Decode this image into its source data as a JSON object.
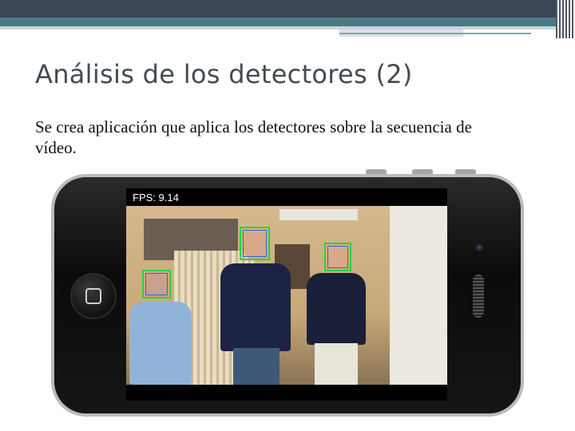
{
  "slide": {
    "title": "Análisis de los detectores (2)",
    "body": "Se crea aplicación que aplica los detectores sobre la secuencia de vídeo."
  },
  "phone_screen": {
    "fps_label": "FPS: 9.14"
  },
  "colors": {
    "title": "#444b52",
    "header_dark": "#3b4553",
    "header_teal": "#4a7a86",
    "face_box": "#21d63a"
  }
}
